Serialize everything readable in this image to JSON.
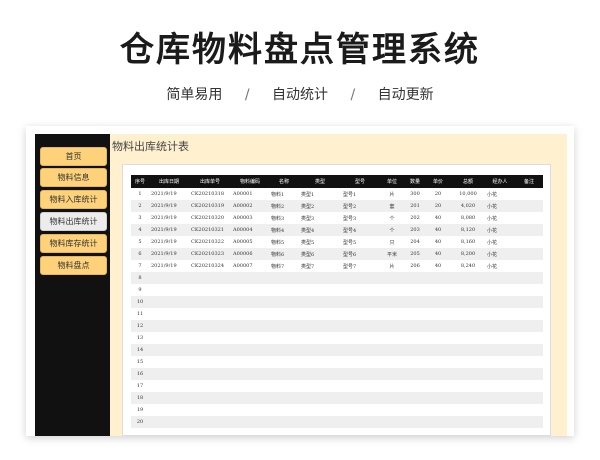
{
  "hero": {
    "title": "仓库物料盘点管理系统",
    "features": [
      "简单易用",
      "自动统计",
      "自动更新"
    ],
    "separator": "/"
  },
  "sidebar": {
    "items": [
      {
        "label": "首页",
        "active": false
      },
      {
        "label": "物料信息",
        "active": false
      },
      {
        "label": "物料入库统计",
        "active": false
      },
      {
        "label": "物料出库统计",
        "active": true
      },
      {
        "label": "物料库存统计",
        "active": false
      },
      {
        "label": "物料盘点",
        "active": false
      }
    ]
  },
  "main": {
    "title": "物料出库统计表",
    "columns": [
      "序号",
      "出库日期",
      "出库单号",
      "物料编码",
      "名称",
      "类型",
      "型号",
      "单位",
      "数量",
      "单价",
      "总额",
      "经办人",
      "备注"
    ],
    "rows": [
      [
        "1",
        "2021/9/19",
        "CK20210318",
        "A00001",
        "物料1",
        "类型1",
        "型号1",
        "片",
        "300",
        "20",
        "10,000",
        "小花",
        ""
      ],
      [
        "2",
        "2021/9/19",
        "CK20210319",
        "A00002",
        "物料2",
        "类型2",
        "型号2",
        "套",
        "201",
        "20",
        "4,020",
        "小花",
        ""
      ],
      [
        "3",
        "2021/9/19",
        "CK20210320",
        "A00003",
        "物料3",
        "类型3",
        "型号3",
        "个",
        "202",
        "40",
        "8,080",
        "小花",
        ""
      ],
      [
        "4",
        "2021/9/19",
        "CK20210321",
        "A00004",
        "物料4",
        "类型4",
        "型号4",
        "个",
        "203",
        "40",
        "8,120",
        "小花",
        ""
      ],
      [
        "5",
        "2021/9/19",
        "CK20210322",
        "A00005",
        "物料5",
        "类型5",
        "型号5",
        "只",
        "204",
        "40",
        "8,160",
        "小花",
        ""
      ],
      [
        "6",
        "2021/9/19",
        "CK20210323",
        "A00006",
        "物料6",
        "类型6",
        "型号6",
        "平米",
        "205",
        "40",
        "8,200",
        "小花",
        ""
      ],
      [
        "7",
        "2021/9/19",
        "CK20210324",
        "A00007",
        "物料7",
        "类型7",
        "型号7",
        "片",
        "206",
        "40",
        "8,240",
        "小花",
        ""
      ],
      [
        "8",
        "",
        "",
        "",
        "",
        "",
        "",
        "",
        "",
        "",
        "",
        "",
        ""
      ],
      [
        "9",
        "",
        "",
        "",
        "",
        "",
        "",
        "",
        "",
        "",
        "",
        "",
        ""
      ],
      [
        "10",
        "",
        "",
        "",
        "",
        "",
        "",
        "",
        "",
        "",
        "",
        "",
        ""
      ],
      [
        "11",
        "",
        "",
        "",
        "",
        "",
        "",
        "",
        "",
        "",
        "",
        "",
        ""
      ],
      [
        "12",
        "",
        "",
        "",
        "",
        "",
        "",
        "",
        "",
        "",
        "",
        "",
        ""
      ],
      [
        "13",
        "",
        "",
        "",
        "",
        "",
        "",
        "",
        "",
        "",
        "",
        "",
        ""
      ],
      [
        "14",
        "",
        "",
        "",
        "",
        "",
        "",
        "",
        "",
        "",
        "",
        "",
        ""
      ],
      [
        "15",
        "",
        "",
        "",
        "",
        "",
        "",
        "",
        "",
        "",
        "",
        "",
        ""
      ],
      [
        "16",
        "",
        "",
        "",
        "",
        "",
        "",
        "",
        "",
        "",
        "",
        "",
        ""
      ],
      [
        "17",
        "",
        "",
        "",
        "",
        "",
        "",
        "",
        "",
        "",
        "",
        "",
        ""
      ],
      [
        "18",
        "",
        "",
        "",
        "",
        "",
        "",
        "",
        "",
        "",
        "",
        "",
        ""
      ],
      [
        "19",
        "",
        "",
        "",
        "",
        "",
        "",
        "",
        "",
        "",
        "",
        "",
        ""
      ],
      [
        "20",
        "",
        "",
        "",
        "",
        "",
        "",
        "",
        "",
        "",
        "",
        "",
        ""
      ]
    ]
  }
}
